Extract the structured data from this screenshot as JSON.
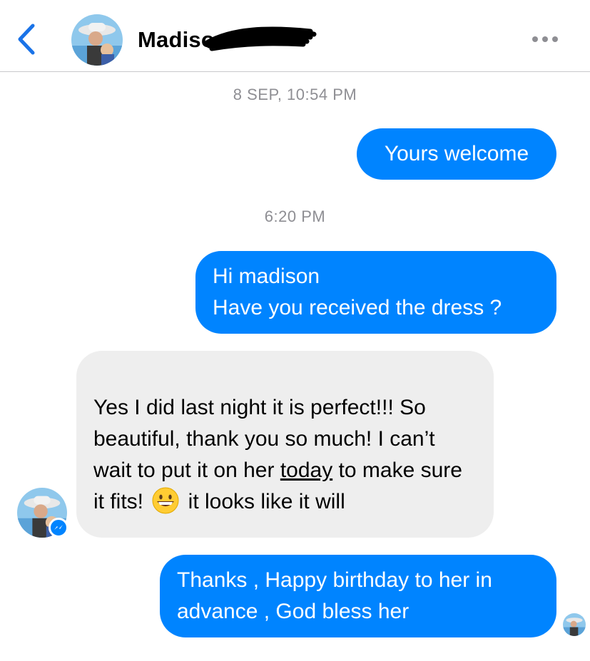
{
  "header": {
    "back_icon": "chevron-left-icon",
    "contact_name": "Madison",
    "more_icon": "ellipsis-icon",
    "accent": "#1a73e8"
  },
  "messages": {
    "ts1": "8 SEP, 10:54 PM",
    "m1": "Yours welcome",
    "ts2": "6:20 PM",
    "m2": "Hi madison\nHave you received the dress ?",
    "m3_part1": "Yes I did last night it is perfect!!! So beautiful, thank you so much! I can’t wait to put it on her ",
    "m3_underlined": "today",
    "m3_part2": " to make sure it fits! ",
    "m3_emoji": "grinning-face-emoji",
    "m3_part3": " it looks like it will",
    "m4": "Thanks , Happy birthday to her in advance , God bless her"
  },
  "colors": {
    "outgoing_bubble": "#0084ff",
    "incoming_bubble": "#eeeeee",
    "timestamp": "#8e8e93"
  }
}
